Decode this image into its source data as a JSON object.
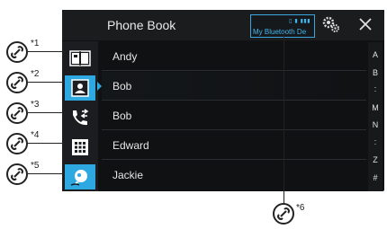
{
  "header": {
    "title": "Phone Book",
    "bt_status": "▯ ▮ ▮▮▮",
    "bt_device": "My Bluetooth De"
  },
  "sidebar": {
    "items": [
      {
        "icon": "phonebook-icon",
        "callout": "*1"
      },
      {
        "icon": "contact-card-icon",
        "callout": "*2"
      },
      {
        "icon": "call-history-icon",
        "callout": "*3"
      },
      {
        "icon": "keypad-icon",
        "callout": "*4"
      },
      {
        "icon": "voice-recognition-icon",
        "callout": "*5"
      }
    ]
  },
  "contacts": [
    {
      "name": "Andy"
    },
    {
      "name": "Bob"
    },
    {
      "name": "Bob"
    },
    {
      "name": "Edward"
    },
    {
      "name": "Jackie"
    }
  ],
  "index_letters": [
    "A",
    "B",
    ":",
    "M",
    "N",
    ":",
    "Z",
    "#"
  ],
  "callout6": "*6",
  "colors": {
    "accent": "#2ea8e0",
    "background": "#0f1112",
    "text": "#e6e6e6"
  }
}
